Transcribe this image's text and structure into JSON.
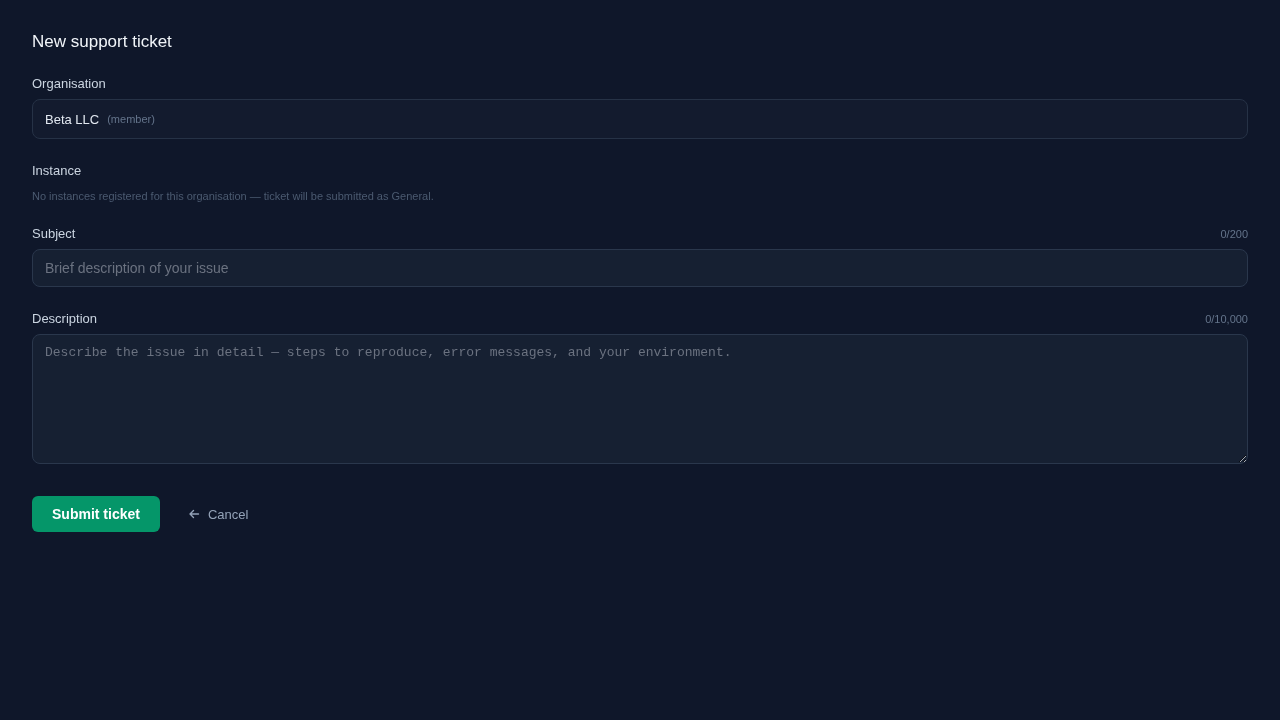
{
  "title": "New support ticket",
  "organisation": {
    "label": "Organisation",
    "value": "Beta LLC",
    "role": "(member)"
  },
  "instance": {
    "label": "Instance",
    "note": "No instances registered for this organisation — ticket will be submitted as General."
  },
  "subject": {
    "label": "Subject",
    "counter": "0/200",
    "placeholder": "Brief description of your issue"
  },
  "description": {
    "label": "Description",
    "counter": "0/10,000",
    "placeholder": "Describe the issue in detail — steps to reproduce, error messages, and your environment."
  },
  "buttons": {
    "submit": "Submit ticket",
    "cancel": "Cancel"
  }
}
